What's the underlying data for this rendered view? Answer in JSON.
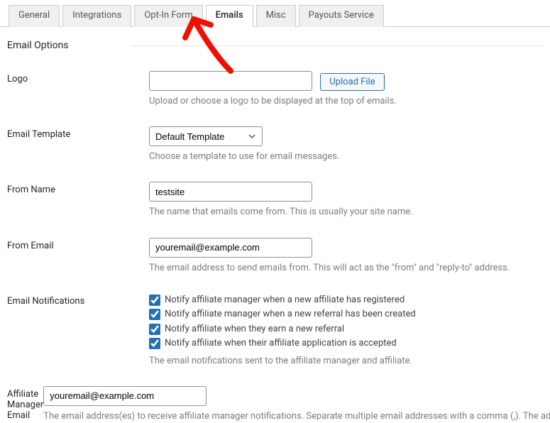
{
  "tabs": {
    "general": "General",
    "integrations": "Integrations",
    "optin": "Opt-In Form",
    "emails": "Emails",
    "misc": "Misc",
    "payouts": "Payouts Service"
  },
  "section": {
    "title": "Email Options"
  },
  "logo": {
    "label": "Logo",
    "value": "",
    "upload_btn": "Upload File",
    "help": "Upload or choose a logo to be displayed at the top of emails."
  },
  "template": {
    "label": "Email Template",
    "value": "Default Template",
    "help": "Choose a template to use for email messages."
  },
  "from_name": {
    "label": "From Name",
    "value": "testsite",
    "help": "The name that emails come from. This is usually your site name."
  },
  "from_email": {
    "label": "From Email",
    "value": "youremail@example.com",
    "help": "The email address to send emails from. This will act as the \"from\" and \"reply-to\" address."
  },
  "notifications": {
    "label": "Email Notifications",
    "opt1": "Notify affiliate manager when a new affiliate has registered",
    "opt2": "Notify affiliate manager when a new referral has been created",
    "opt3": "Notify affiliate when they earn a new referral",
    "opt4": "Notify affiliate when their affiliate application is accepted",
    "help": "The email notifications sent to the affiliate manager and affiliate."
  },
  "manager_email": {
    "label": "Affiliate Manager Email",
    "value": "youremail@example.com",
    "help": "The email address(es) to receive affiliate manager notifications. Separate multiple email addresses with a comma (,). The adr"
  }
}
